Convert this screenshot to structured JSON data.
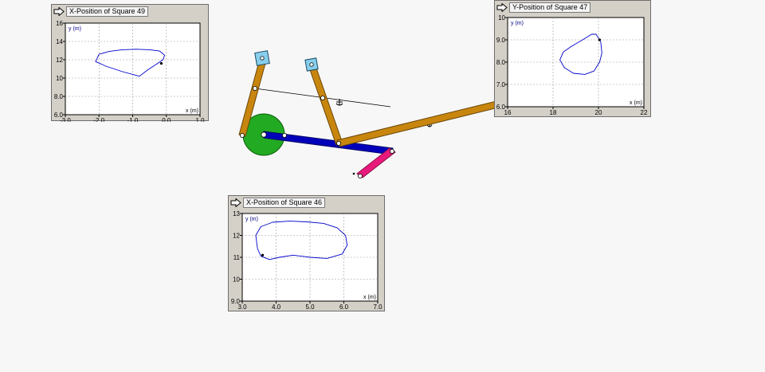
{
  "colors": {
    "background": "#f7f7f7",
    "meter_frame": "#d4d0c8",
    "plot_line": "#0000cc",
    "axis_label": "#000080",
    "brown_link": "#c8860f",
    "blue_link": "#0000bb",
    "pink_link": "#e8197a",
    "wheel": "#22aa22",
    "square": "#87ceeb",
    "pin_fill": "#ffffff"
  },
  "mechanism": {
    "icon": "linkage-mechanism"
  },
  "meters": [
    {
      "title": "X-Position of Square 49",
      "icon": "export-arrow-icon",
      "x_label": "x (m)",
      "y_label": "y (m)",
      "x_ticks": [
        "-3.0",
        "-2.0",
        "-1.0",
        "0.0",
        "1.0"
      ],
      "y_ticks": [
        "6.0",
        "8.0",
        "10",
        "12",
        "14",
        "16"
      ],
      "chart_data": {
        "type": "line",
        "xlim": [
          -3.0,
          1.0
        ],
        "ylim": [
          6.0,
          16.0
        ],
        "grid": true,
        "x": [
          -2.0,
          -1.7,
          -1.3,
          -0.9,
          -0.5,
          -0.2,
          -0.05,
          -0.1,
          -0.3,
          -0.55,
          -0.8,
          -1.3,
          -1.8,
          -2.1,
          -2.0
        ],
        "y": [
          12.6,
          12.9,
          13.1,
          13.15,
          13.1,
          12.95,
          12.5,
          12.0,
          11.5,
          10.9,
          10.2,
          10.7,
          11.3,
          11.8,
          12.6
        ],
        "marker": {
          "x": -0.15,
          "y": 11.6
        }
      }
    },
    {
      "title": "Y-Position of Square 47",
      "icon": "export-arrow-icon",
      "x_label": "x (m)",
      "y_label": "y (m)",
      "x_ticks": [
        "16",
        "18",
        "20",
        "22"
      ],
      "y_ticks": [
        "6.0",
        "7.0",
        "8.0",
        "9.0",
        "10"
      ],
      "chart_data": {
        "type": "line",
        "xlim": [
          16,
          22
        ],
        "ylim": [
          6.0,
          10.0
        ],
        "grid": true,
        "x": [
          19.9,
          20.1,
          20.15,
          20.05,
          19.8,
          19.4,
          18.9,
          18.5,
          18.3,
          18.45,
          18.8,
          19.3,
          19.7,
          19.9
        ],
        "y": [
          9.25,
          8.9,
          8.4,
          8.0,
          7.6,
          7.45,
          7.5,
          7.75,
          8.1,
          8.45,
          8.7,
          9.0,
          9.25,
          9.25
        ],
        "marker": {
          "x": 20.05,
          "y": 9.0
        }
      }
    },
    {
      "title": "X-Position of Square 46",
      "icon": "export-arrow-icon",
      "x_label": "x (m)",
      "y_label": "y (m)",
      "x_ticks": [
        "3.0",
        "4.0",
        "5.0",
        "6.0",
        "7.0"
      ],
      "y_ticks": [
        "9.0",
        "10",
        "11",
        "12",
        "13"
      ],
      "chart_data": {
        "type": "line",
        "xlim": [
          3.0,
          7.0
        ],
        "ylim": [
          9.0,
          13.0
        ],
        "grid": true,
        "x": [
          3.45,
          3.4,
          3.55,
          3.9,
          4.4,
          4.9,
          5.4,
          5.8,
          6.05,
          6.1,
          5.95,
          5.5,
          5.0,
          4.5,
          4.1,
          3.8,
          3.55,
          3.45
        ],
        "y": [
          11.4,
          12.0,
          12.4,
          12.6,
          12.65,
          12.62,
          12.55,
          12.35,
          12.0,
          11.55,
          11.15,
          10.95,
          11.0,
          11.1,
          11.0,
          10.9,
          11.05,
          11.4
        ],
        "marker": {
          "x": 3.6,
          "y": 11.1
        }
      }
    }
  ]
}
